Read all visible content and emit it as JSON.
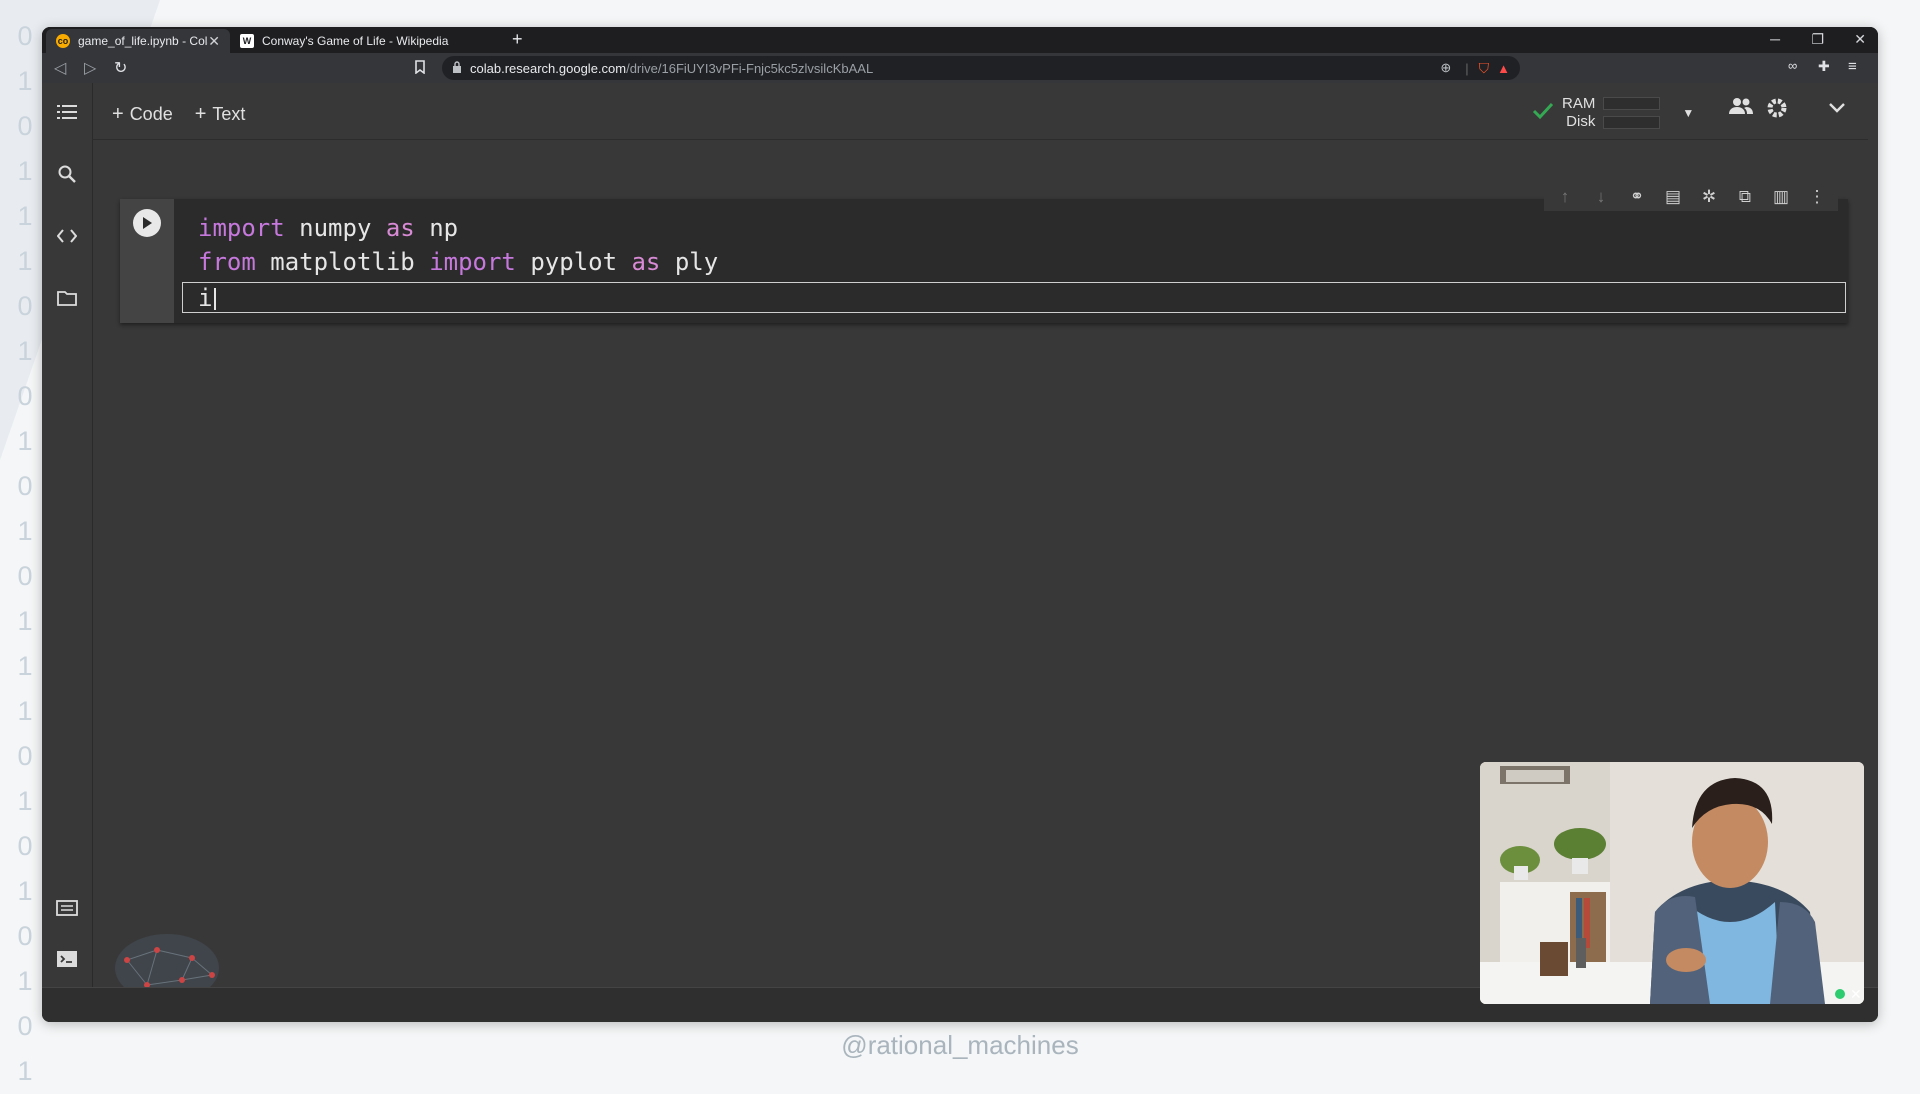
{
  "background": {
    "binary_digits": [
      "0",
      "1",
      "0",
      "1",
      "1",
      "1",
      "0",
      "1",
      "0",
      "1",
      "0",
      "1",
      "0",
      "1",
      "1",
      "1",
      "0",
      "1",
      "0",
      "1",
      "0",
      "1",
      "0",
      "1"
    ]
  },
  "browser": {
    "tabs": [
      {
        "title": "game_of_life.ipynb - Colaborator",
        "favicon": "colab-logo-icon",
        "active": true
      },
      {
        "title": "Conway's Game of Life - Wikipedia",
        "favicon": "wikipedia-w-icon",
        "active": false
      }
    ],
    "url_host": "colab.research.google.com",
    "url_path": "/drive/16FiUYI3vPFi-Fnjc5kc5zlvsilcKbAAL"
  },
  "colab": {
    "add_code_label": "Code",
    "add_text_label": "Text",
    "ram_label": "RAM",
    "disk_label": "Disk",
    "status_color": "#34a853"
  },
  "cell": {
    "lines": [
      {
        "kw1": "import",
        "t1": " numpy ",
        "kw2": "as",
        "t2": " np"
      },
      {
        "kw1": "from",
        "t1": " matplotlib ",
        "kw2": "import",
        "t2": " pyplot ",
        "kw3": "as",
        "t3": " ply"
      }
    ],
    "current_line": "i"
  },
  "watermark": "@rational_machines"
}
